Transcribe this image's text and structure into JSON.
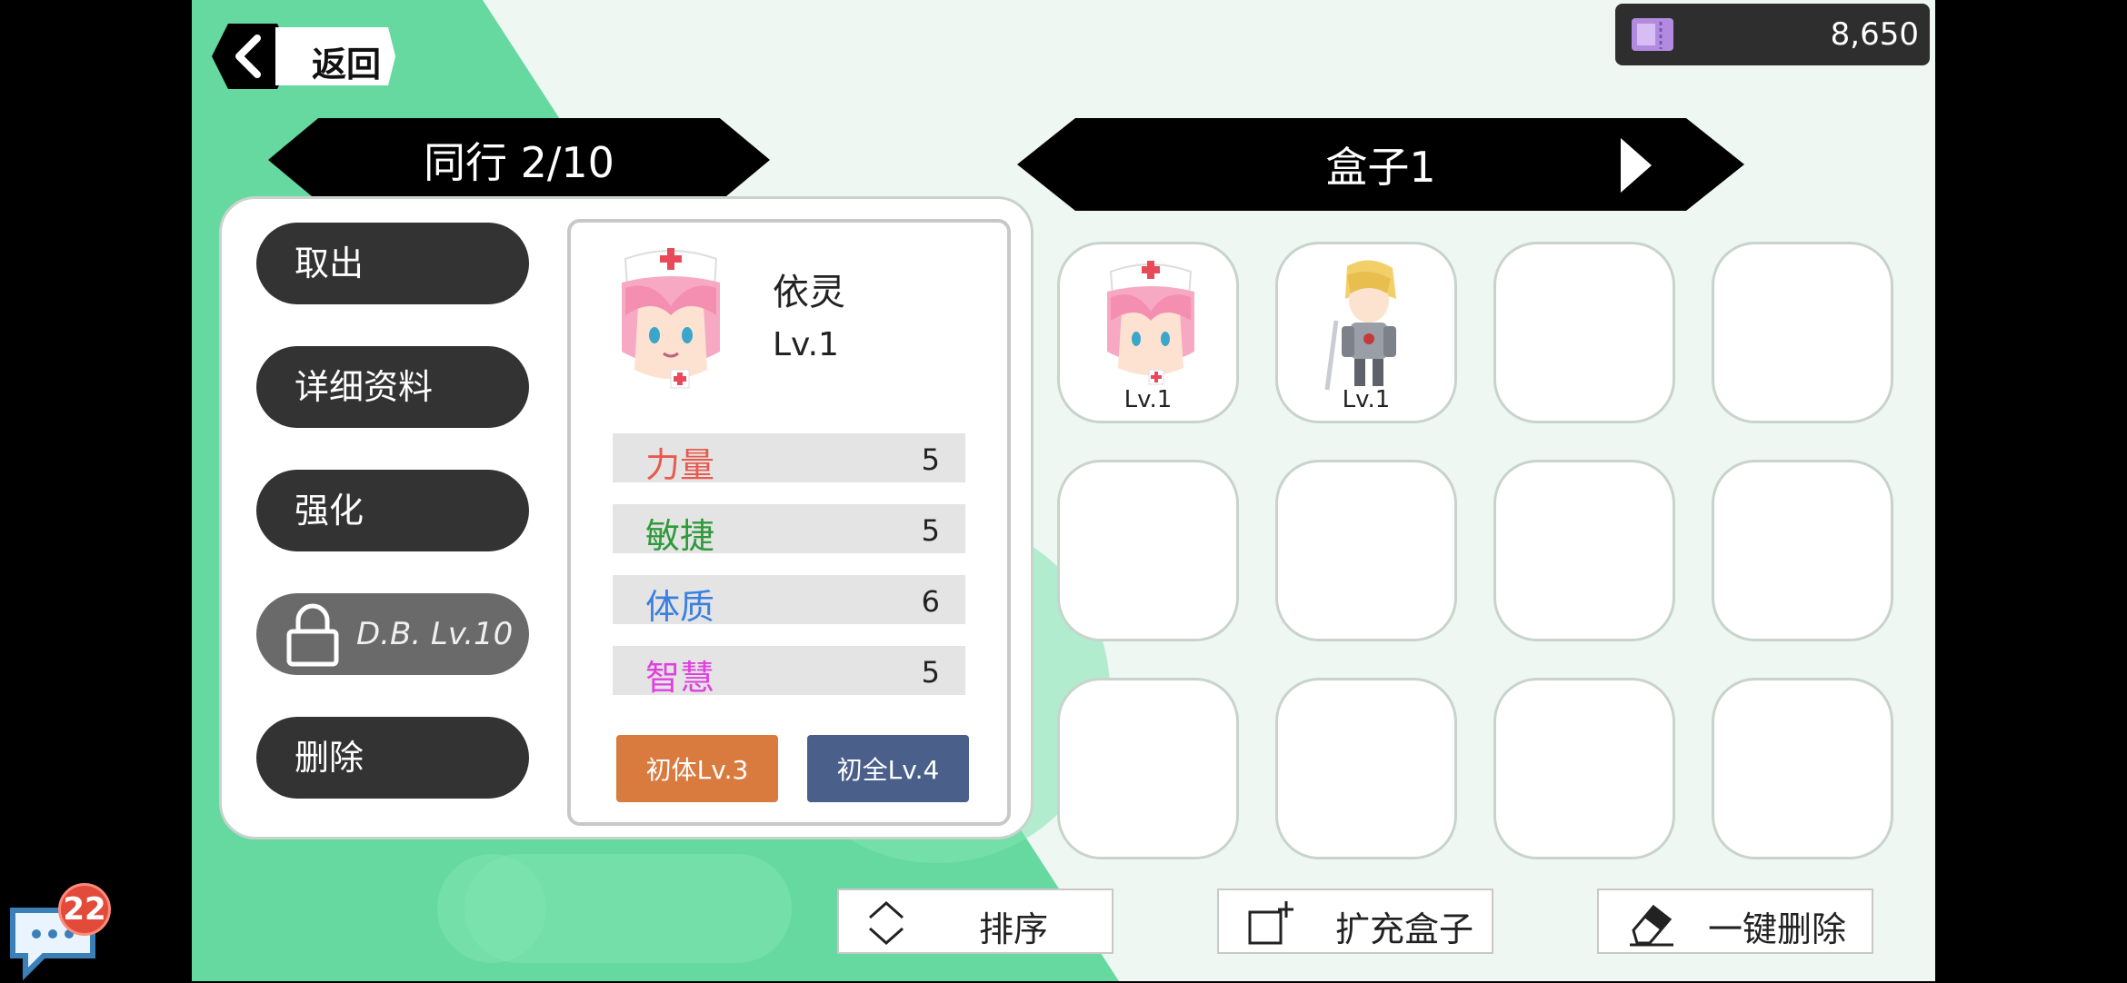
{
  "header": {
    "back_label": "返回",
    "currency_value": "8,650",
    "currency_icon": "ticket-icon"
  },
  "party": {
    "title": "同行 2/10"
  },
  "box": {
    "title": "盒子1"
  },
  "menu": {
    "take_out": "取出",
    "details": "详细资料",
    "enhance": "强化",
    "locked_label": "D.B. Lv.10",
    "delete": "删除"
  },
  "character": {
    "name": "依灵",
    "level": "Lv.1",
    "stats": [
      {
        "name": "力量",
        "value": "5",
        "color": "#e85a4f"
      },
      {
        "name": "敏捷",
        "value": "5",
        "color": "#2f9a3a"
      },
      {
        "name": "体质",
        "value": "6",
        "color": "#3b7fe0"
      },
      {
        "name": "智慧",
        "value": "5",
        "color": "#e040e0"
      }
    ],
    "tag1": "初体Lv.3",
    "tag2": "初全Lv.4",
    "tag1_color": "#d97a3f",
    "tag2_color": "#4a5f8a"
  },
  "slots": [
    {
      "level": "Lv.1"
    },
    {
      "level": "Lv.1"
    }
  ],
  "bottom_bar": {
    "sort": "排序",
    "expand": "扩充盒子",
    "delete_all": "一键删除"
  },
  "chat": {
    "badge": "22"
  }
}
